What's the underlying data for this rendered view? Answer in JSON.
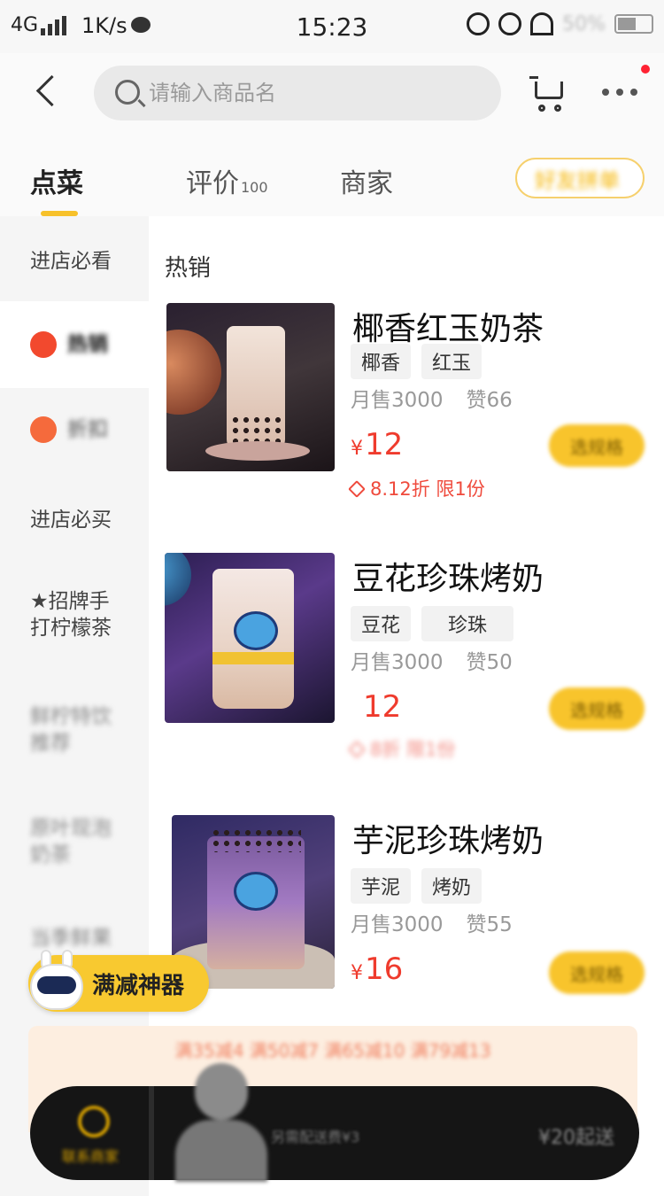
{
  "status_bar": {
    "network": "4G",
    "speed": "1K/s",
    "time": "15:23",
    "battery": "50%"
  },
  "header": {
    "search_placeholder": "请输入商品名"
  },
  "tabs": {
    "items": [
      {
        "label": "点菜"
      },
      {
        "label": "评价",
        "count": "100"
      },
      {
        "label": "商家"
      }
    ],
    "group_button": "好友拼单"
  },
  "sidebar": {
    "categories": [
      {
        "label": "进店必看"
      },
      {
        "label": "热销"
      },
      {
        "label": "折扣"
      },
      {
        "label": "进店必买"
      },
      {
        "label": "★招牌手打柠檬茶"
      },
      {
        "label": "鲜柠特饮推荐"
      },
      {
        "label": "原叶现泡奶茶"
      },
      {
        "label": "当季鲜果"
      }
    ]
  },
  "main": {
    "section_title": "热销",
    "products": [
      {
        "name": "椰香红玉奶茶",
        "tags": [
          "椰香",
          "红玉"
        ],
        "monthly_sales": "月售3000",
        "likes": "赞66",
        "price": "12",
        "currency": "¥",
        "discount": "8.12折 限1份",
        "button": "选规格"
      },
      {
        "name": "豆花珍珠烤奶",
        "tags": [
          "豆花",
          "珍珠"
        ],
        "monthly_sales": "月售3000",
        "likes": "赞50",
        "price": "12",
        "currency": "",
        "discount": "8折 限1份",
        "button": "选规格"
      },
      {
        "name": "芋泥珍珠烤奶",
        "tags": [
          "芋泥",
          "烤奶"
        ],
        "monthly_sales": "月售3000",
        "likes": "赞55",
        "price": "16",
        "currency": "¥",
        "discount": "",
        "button": "选规格"
      }
    ]
  },
  "promo_float": {
    "label": "满减神器"
  },
  "discount_strip": {
    "text": "满35减4 满50减7 满65减10 满79减13"
  },
  "cart_bar": {
    "contact_label": "联系商家",
    "delivery": "另需配送费¥3",
    "min_order": "¥20起送"
  },
  "colors": {
    "accent_yellow": "#f8c42c",
    "price_red": "#ef3b2d"
  }
}
